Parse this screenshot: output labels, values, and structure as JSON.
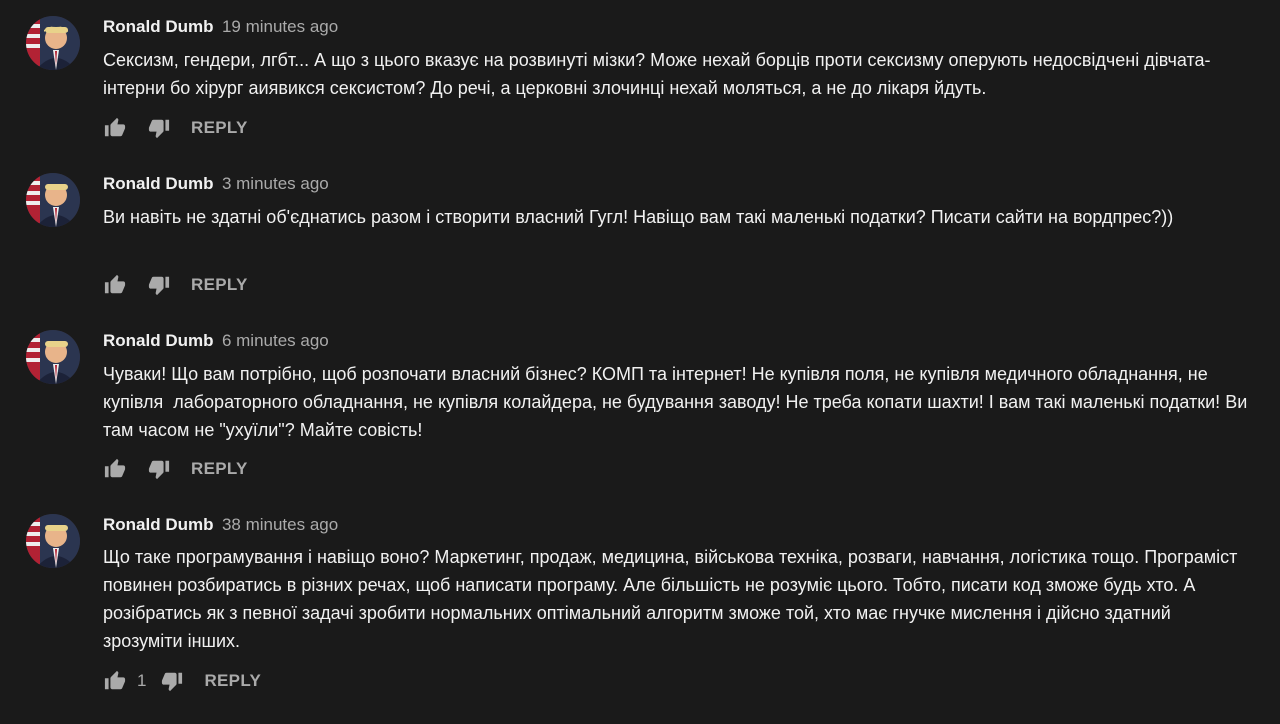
{
  "comments": [
    {
      "author": "Ronald Dumb",
      "time": "19 minutes ago",
      "text": "Сексизм, гендери, лгбт... А що з цього вказує на розвинуті мізки? Може нехай борців проти сексизму оперують недосвідчені дівчата-інтерни бо хірург аиявикся сексистом? До речі, а церковні злочинці нехай моляться, а не до лікаря йдуть.",
      "likes": "",
      "reply_label": "REPLY"
    },
    {
      "author": "Ronald Dumb",
      "time": "3 minutes ago",
      "text": "Ви навіть не здатні об'єднатись разом і створити власний Гугл! Навіщо вам такі маленькі податки? Писати сайти на вордпрес?))",
      "likes": "",
      "reply_label": "REPLY"
    },
    {
      "author": "Ronald Dumb",
      "time": "6 minutes ago",
      "text": "Чуваки! Що вам потрібно, щоб розпочати власний бізнес? КОМП та інтернет! Не купівля поля, не купівля медичного обладнання, не купівля  лабораторного обладнання, не купівля колайдера, не будування заводу! Не треба копати шахти! І вам такі маленькі податки! Ви там часом не \"ухуїли\"? Майте совість!",
      "likes": "",
      "reply_label": "REPLY"
    },
    {
      "author": "Ronald Dumb",
      "time": "38 minutes ago",
      "text": "Що таке програмування і навіщо воно? Маркетинг, продаж, медицина, військова техніка, розваги, навчання, логістика тощо. Програміст повинен розбиратись в різних речах, щоб написати програму. Але більшість не розуміє цього. Тобто, писати код зможе будь хто. А розібратись як з певної задачі зробити нормальних оптімальний алгоритм зможе той, хто має гнучке мислення і дійсно здатний зрозуміти інших.",
      "likes": "1",
      "reply_label": "REPLY"
    }
  ],
  "icons": {
    "like": "thumb-up-icon",
    "dislike": "thumb-down-icon",
    "avatar": "user-avatar"
  },
  "colors": {
    "background": "#1a1a1a",
    "text": "#f1f1f1",
    "secondary": "#aaaaaa"
  }
}
